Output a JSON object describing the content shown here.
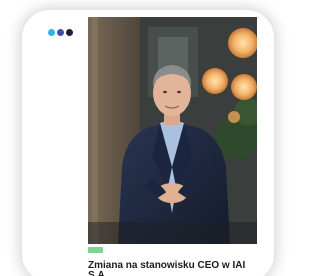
{
  "window_controls": {
    "dot_colors": [
      "#29b6e8",
      "#3d4fa8",
      "#1b2240"
    ]
  },
  "article": {
    "image_icon": "ceo-portrait-photo",
    "category_badge_color": "#7fd38f",
    "date_text": "",
    "headline": "Zmiana na stanowisku CEO w IAI S.A."
  }
}
